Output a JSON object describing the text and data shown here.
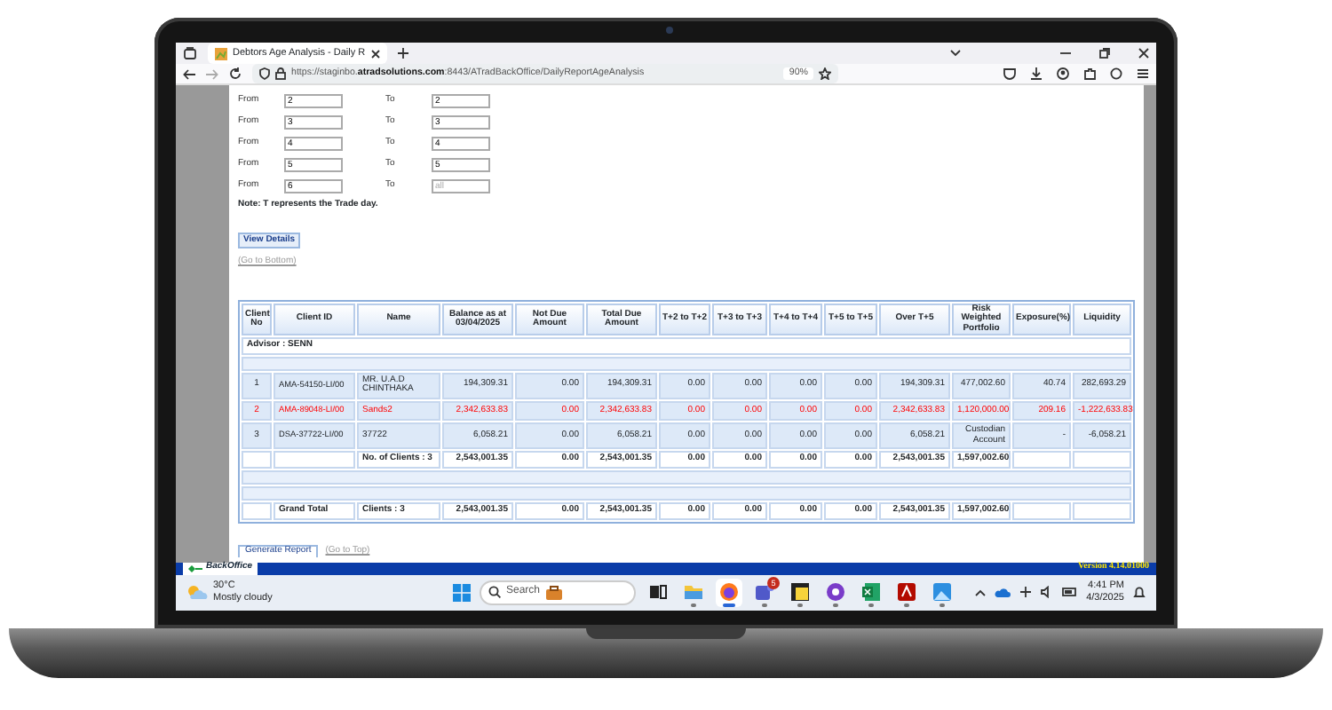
{
  "browser": {
    "tab_title": "Debtors Age Analysis - Daily R",
    "url": "https://staginbo.**atradsolutions.com**:8443/ATradBackOffice/DailyReportAgeAnalysis",
    "zoom": "90%"
  },
  "range_form": {
    "rows": [
      {
        "from_label": "From",
        "from": "2",
        "to_label": "To",
        "to": "2"
      },
      {
        "from_label": "From",
        "from": "3",
        "to_label": "To",
        "to": "3"
      },
      {
        "from_label": "From",
        "from": "4",
        "to_label": "To",
        "to": "4"
      },
      {
        "from_label": "From",
        "from": "5",
        "to_label": "To",
        "to": "5"
      },
      {
        "from_label": "From",
        "from": "6",
        "to_label": "To",
        "to_placeholder": "all"
      }
    ],
    "note": "Note: T represents the Trade day."
  },
  "view_details": "View Details",
  "go_to_bottom": "(Go to Bottom)",
  "table": {
    "columns": [
      "Client No",
      "Client ID",
      "Name",
      "Balance as at 03/04/2025",
      "Not Due Amount",
      "Total Due Amount",
      "T+2 to T+2",
      "T+3 to T+3",
      "T+4 to T+4",
      "T+5 to T+5",
      "Over T+5",
      "Risk Weighted Portfolio",
      "Exposure(%)",
      "Liquidity"
    ],
    "rows": [
      {
        "kind": "advisor",
        "text": "Advisor : SENN"
      },
      {
        "kind": "blank"
      },
      {
        "kind": "data",
        "highlighted": false,
        "cells": [
          "1",
          "AMA-54150-LI/00",
          "MR. U.A.D CHINTHAKA",
          "194,309.31",
          "0.00",
          "194,309.31",
          "0.00",
          "0.00",
          "0.00",
          "0.00",
          "194,309.31",
          "477,002.60",
          "40.74",
          "282,693.29"
        ]
      },
      {
        "kind": "data",
        "highlighted": true,
        "cells": [
          "2",
          "AMA-89048-LI/00",
          "Sands2",
          "2,342,633.83",
          "0.00",
          "2,342,633.83",
          "0.00",
          "0.00",
          "0.00",
          "0.00",
          "2,342,633.83",
          "1,120,000.00",
          "209.16",
          "-1,222,633.83"
        ]
      },
      {
        "kind": "data",
        "highlighted": false,
        "cells": [
          "3",
          "DSA-37722-LI/00",
          "37722",
          "6,058.21",
          "0.00",
          "6,058.21",
          "0.00",
          "0.00",
          "0.00",
          "0.00",
          "6,058.21",
          "Custodian Account",
          "-",
          "-6,058.21"
        ]
      },
      {
        "kind": "subtotal",
        "cells": [
          null,
          null,
          "No. of Clients : 3",
          "2,543,001.35",
          "0.00",
          "2,543,001.35",
          "0.00",
          "0.00",
          "0.00",
          "0.00",
          "2,543,001.35",
          "1,597,002.60",
          null,
          null
        ]
      },
      {
        "kind": "blank"
      },
      {
        "kind": "blank"
      },
      {
        "kind": "total",
        "cells": [
          null,
          "Grand Total",
          "Clients : 3",
          "2,543,001.35",
          "0.00",
          "2,543,001.35",
          "0.00",
          "0.00",
          "0.00",
          "0.00",
          "2,543,001.35",
          "1,597,002.60",
          null,
          null
        ]
      }
    ]
  },
  "generate_report": "Generate Report",
  "go_to_top": "(Go to Top)",
  "footer": {
    "logo": "BackOffice",
    "version": "Version 4.14.01000"
  },
  "taskbar": {
    "temperature": "30°C",
    "weather": "Mostly cloudy",
    "search_placeholder": "Search",
    "apps": [
      {
        "kind": "task-view",
        "active": false,
        "running": false
      },
      {
        "kind": "folder",
        "active": false,
        "running": true
      },
      {
        "kind": "browser",
        "active": true,
        "running": true
      },
      {
        "kind": "chat",
        "active": false,
        "running": true,
        "badge": "5"
      },
      {
        "kind": "note",
        "active": false,
        "running": true
      },
      {
        "kind": "circle-app",
        "active": false,
        "running": true
      },
      {
        "kind": "spreadsheet",
        "active": false,
        "running": true
      },
      {
        "kind": "pdf",
        "active": false,
        "running": true
      },
      {
        "kind": "photo",
        "active": false,
        "running": true
      }
    ],
    "time": "4:41 PM",
    "date": "4/3/2025"
  }
}
